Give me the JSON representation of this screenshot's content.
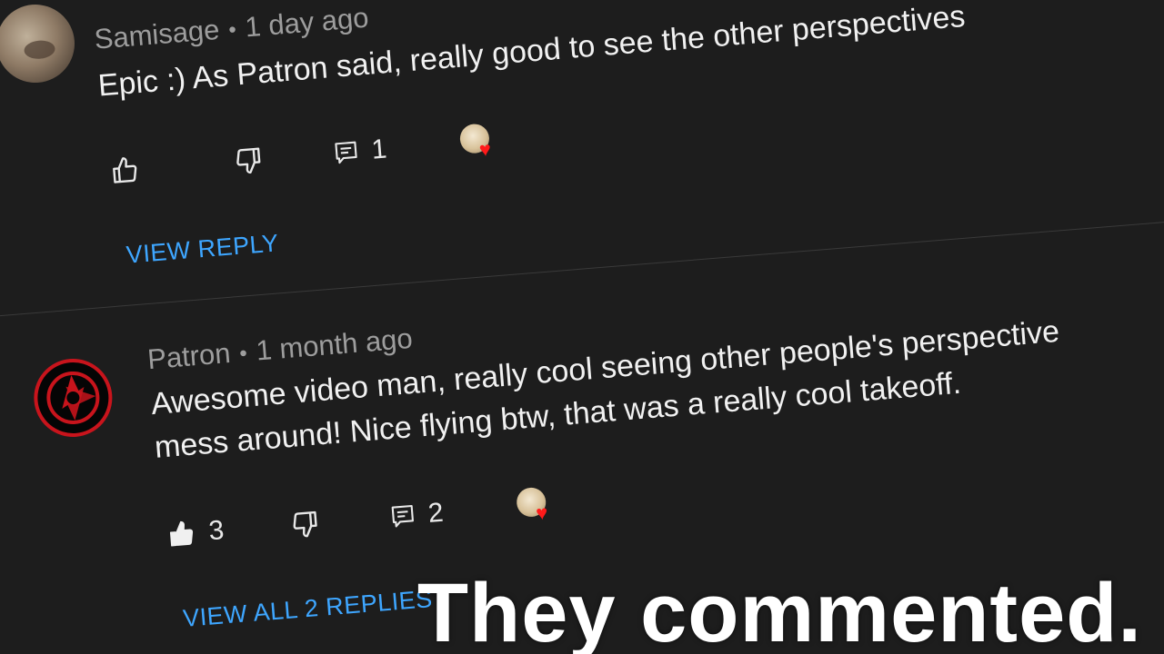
{
  "comments": [
    {
      "author": "Samisage",
      "time": "1 day ago",
      "text": "Epic :) As Patron said, really good to see the other perspectives",
      "likes": "",
      "replies_count": "1",
      "replies_link": "VIEW REPLY"
    },
    {
      "author": "Patron",
      "time": "1 month ago",
      "text_line1": "Awesome video man, really cool seeing other people's perspective",
      "text_line2": "mess around! Nice flying btw, that was a really cool takeoff.",
      "likes": "3",
      "replies_count": "2",
      "replies_link": "VIEW ALL 2 REPLIES"
    }
  ],
  "overlay_caption": "They commented.",
  "colors": {
    "background": "#1d1d1d",
    "link": "#3ea6ff",
    "meta": "#9d9d9d",
    "heart": "#ff1a1a",
    "logo_red": "#c8141c"
  },
  "icons": [
    "thumbs-up-icon",
    "thumbs-down-icon",
    "reply-icon",
    "creator-heart-icon"
  ]
}
